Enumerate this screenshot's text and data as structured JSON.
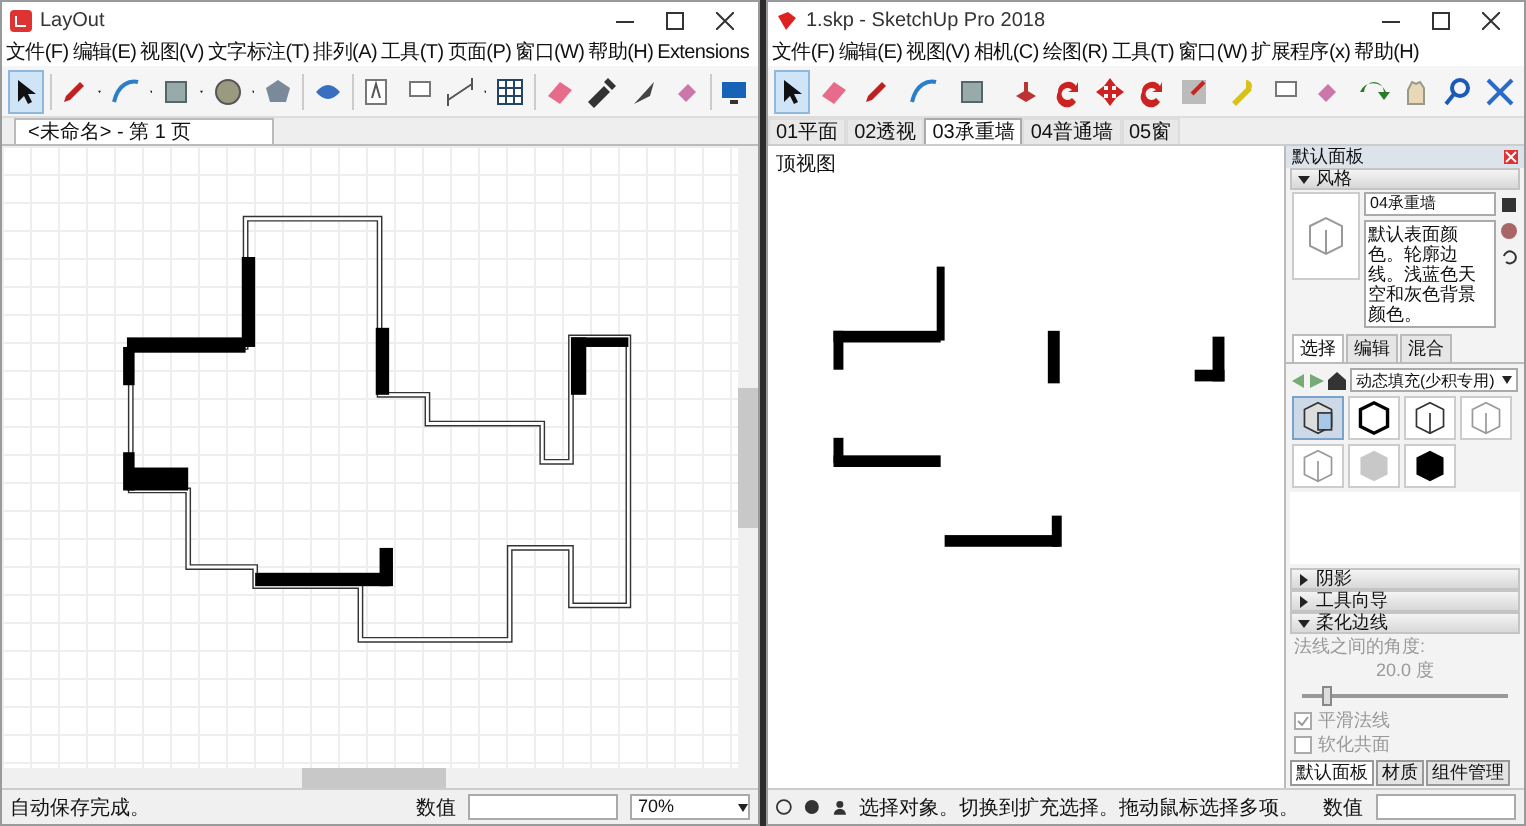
{
  "layout_window": {
    "title": "LayOut",
    "menu": [
      "文件(F)",
      "编辑(E)",
      "视图(V)",
      "文字标注(T)",
      "排列(A)",
      "工具(T)",
      "页面(P)",
      "窗口(W)",
      "帮助(H)",
      "Extensions"
    ],
    "document_tab": "<未命名> - 第 1 页",
    "status": "自动保存完成。",
    "measurements_label": "数值",
    "zoom": "70%"
  },
  "sketchup_window": {
    "title": "1.skp - SketchUp Pro 2018",
    "menu": [
      "文件(F)",
      "编辑(E)",
      "视图(V)",
      "相机(C)",
      "绘图(R)",
      "工具(T)",
      "窗口(W)",
      "扩展程序(x)",
      "帮助(H)"
    ],
    "scenes": [
      {
        "label": "01平面",
        "selected": false
      },
      {
        "label": "02透视",
        "selected": false
      },
      {
        "label": "03承重墙",
        "selected": true
      },
      {
        "label": "04普通墙",
        "selected": false
      },
      {
        "label": "05窗",
        "selected": false
      }
    ],
    "view_label": "顶视图",
    "tray": {
      "title": "默认面板",
      "styles": {
        "header": "风格",
        "style_name": "04承重墙",
        "description": "默认表面颜色。轮廓边线。浅蓝色天空和灰色背景颜色。",
        "tabs": [
          {
            "label": "选择",
            "selected": true
          },
          {
            "label": "编辑",
            "selected": false
          },
          {
            "label": "混合",
            "selected": false
          }
        ],
        "collection": "动态填充(少积专用)",
        "thumbnails": [
          {
            "kind": "shaded",
            "selected": true
          },
          {
            "kind": "bold",
            "selected": false
          },
          {
            "kind": "outline",
            "selected": false
          },
          {
            "kind": "sketch",
            "selected": false
          },
          {
            "kind": "sketch",
            "selected": false
          },
          {
            "kind": "grey",
            "selected": false
          },
          {
            "kind": "black",
            "selected": false
          }
        ]
      },
      "sections": [
        {
          "label": "阴影",
          "expanded": false
        },
        {
          "label": "工具向导",
          "expanded": false
        },
        {
          "label": "柔化边线",
          "expanded": true
        }
      ],
      "soften": {
        "angle_label": "法线之间的角度:",
        "angle_value": "20.0 度",
        "level": 0.12,
        "options": [
          {
            "label": "平滑法线",
            "checked": true
          },
          {
            "label": "软化共面",
            "checked": false
          }
        ]
      },
      "tray_tabs": [
        {
          "label": "默认面板",
          "selected": true
        },
        {
          "label": "材质",
          "selected": false
        },
        {
          "label": "组件管理",
          "selected": false
        }
      ]
    },
    "status": "选择对象。切换到扩充选择。拖动鼠标选择多项。",
    "measurements_label": "数值"
  }
}
